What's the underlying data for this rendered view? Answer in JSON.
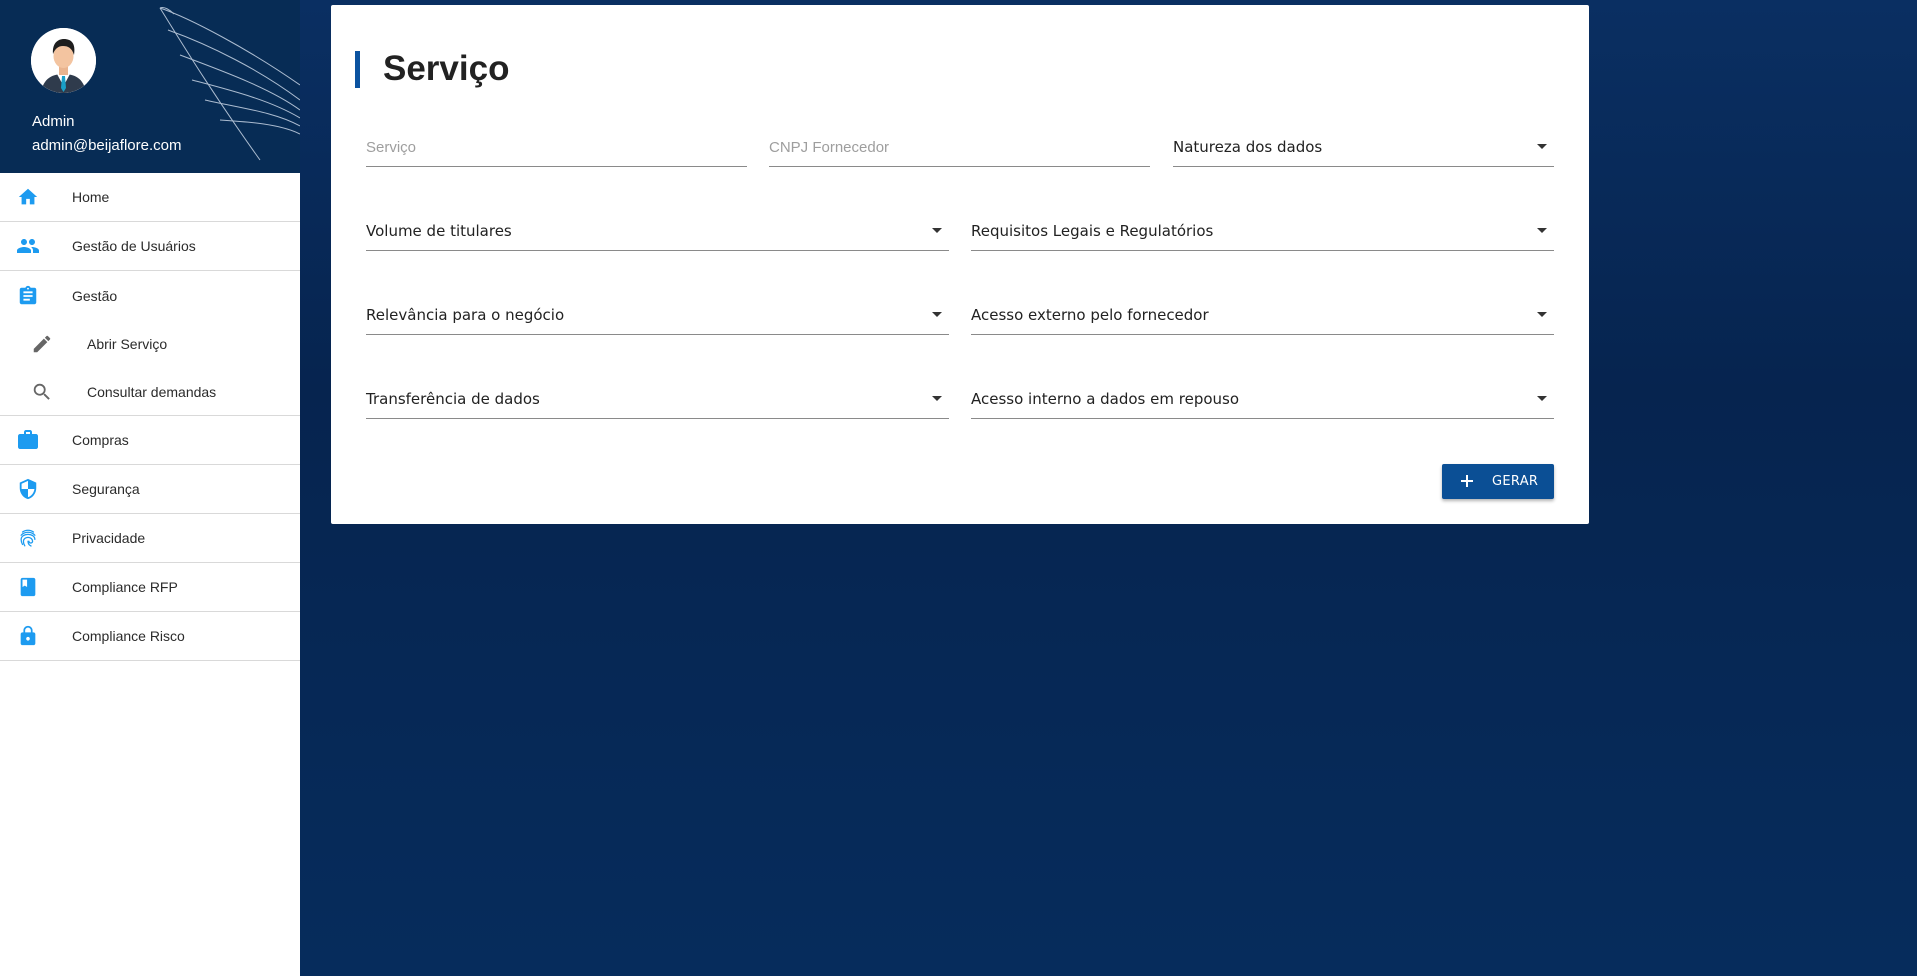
{
  "user": {
    "name": "Admin",
    "email": "admin@beijaflore.com"
  },
  "nav": {
    "items": [
      {
        "label": "Home",
        "icon": "home-icon"
      },
      {
        "label": "Gestão de Usuários",
        "icon": "users-icon"
      },
      {
        "label": "Gestão",
        "icon": "clipboard-icon"
      },
      {
        "label": "Abrir Serviço",
        "icon": "pencil-icon"
      },
      {
        "label": "Consultar demandas",
        "icon": "search-icon"
      },
      {
        "label": "Compras",
        "icon": "briefcase-icon"
      },
      {
        "label": "Segurança",
        "icon": "shield-icon"
      },
      {
        "label": "Privacidade",
        "icon": "fingerprint-icon"
      },
      {
        "label": "Compliance RFP",
        "icon": "book-icon"
      },
      {
        "label": "Compliance Risco",
        "icon": "lock-icon"
      }
    ]
  },
  "form": {
    "title": "Serviço",
    "servico_placeholder": "Serviço",
    "cnpj_placeholder": "CNPJ Fornecedor",
    "natureza": "Natureza dos dados",
    "volume": "Volume de titulares",
    "requisitos": "Requisitos Legais e Regulatórios",
    "relevancia": "Relevância para o negócio",
    "acesso_externo": "Acesso externo pelo fornecedor",
    "transferencia": "Transferência de dados",
    "acesso_interno": "Acesso interno a dados em repouso",
    "submit_label": "GERAR"
  },
  "colors": {
    "accent": "#0b53a0",
    "icon_blue": "#1d9bf0",
    "header_bg": "#072c55",
    "page_bg": "#062c5c"
  }
}
